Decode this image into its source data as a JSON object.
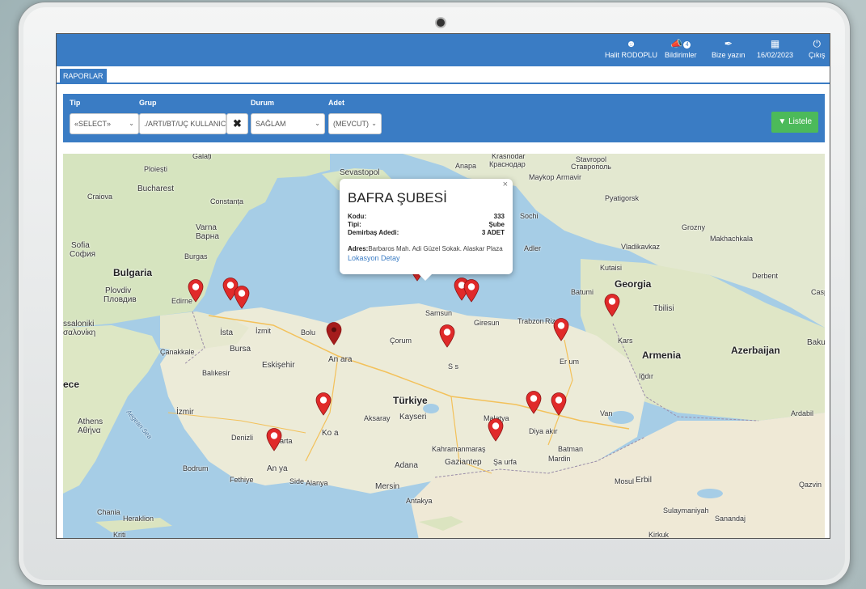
{
  "topbar": {
    "user": "Halit RODOPLU",
    "notifications": "Bildirimler",
    "notif_count": "4",
    "write": "Bize yazın",
    "date": "16/02/2023",
    "logout": "Çıkış"
  },
  "tabs": [
    "RAPORLAR"
  ],
  "filters": {
    "tip_label": "Tip",
    "tip_value": "«SELECT»",
    "grup_label": "Grup",
    "grup_value": "./ARTI/BT/UÇ KULLANICI",
    "durum_label": "Durum",
    "durum_value": "SAĞLAM",
    "adet_label": "Adet",
    "adet_value": "(MEVCUT)",
    "list_button": "Listele"
  },
  "popup": {
    "title": "BAFRA ŞUBESİ",
    "kodu_label": "Kodu:",
    "kodu_value": "333",
    "tipi_label": "Tipi:",
    "tipi_value": "Şube",
    "demirbas_label": "Demirbaş Adedi:",
    "demirbas_value": "3 ADET",
    "adres_label": "Adres:",
    "adres_value": "Barbaros Mah. Adi Güzel Sokak. Alaskar Plaza",
    "link": "Lokasyon Detay",
    "close": "×"
  },
  "map_labels": {
    "krasnodar": "Krasnodar",
    "krasnodar_ru": "Краснодар",
    "stavropol": "Stavropol",
    "stavropol_ru": "Ставрополь",
    "galati": "Galați",
    "ploiesti": "Ploiești",
    "sevastopol": "Sevastopol",
    "anapa": "Anapa",
    "maykop": "Maykop",
    "armavir": "Armavir",
    "craiova": "Craiova",
    "bucharest": "Bucharest",
    "constanta": "Constanța",
    "pyatigorsk": "Pyatigorsk",
    "varna": "Varna",
    "varna_bg": "Варна",
    "sochi": "Sochi",
    "grozny": "Grozny",
    "sofia": "Sofia",
    "sofia_bg": "София",
    "burgas": "Burgas",
    "adler": "Adler",
    "makhachkala": "Makhachkala",
    "vladikavkaz": "Vladikavkaz",
    "bulgaria": "Bulgaria",
    "kutaisi": "Kutaisi",
    "derbent": "Derbent",
    "plovdiv": "Plovdiv",
    "plovdiv_bg": "Пловдив",
    "edirne": "Edirne",
    "georgia": "Georgia",
    "batumi": "Batumi",
    "samsun": "Samsun",
    "tbilisi": "Tbilisi",
    "caspian": "Casp",
    "thessaloniki": "ssaloniki",
    "thessaloniki_gr": "σαλονίκη",
    "istanbul": "İsta",
    "izmit": "İzmit",
    "bolu": "Bolu",
    "giresun": "Giresun",
    "trabzon": "Trabzon",
    "rize": "Rize",
    "kars": "Kars",
    "baku": "Baku",
    "canakkale": "Çanakkale",
    "corum": "Çorum",
    "bursa": "Bursa",
    "armenia": "Armenia",
    "azerbaijan": "Azerbaijan",
    "balikesir": "Balıkesir",
    "eskisehir": "Eskişehir",
    "ankara": "An  ara",
    "sivas": "S  s",
    "erzurum": "Er  um",
    "igdir": "Iğdır",
    "greece": "ece",
    "turkiye": "Türkiye",
    "izmir": "İzmir",
    "aksaray": "Aksaray",
    "kayseri": "Kayseri",
    "malatya": "Malatya",
    "van": "Van",
    "ardabil": "Ardabil",
    "athens": "Athens",
    "athens_gr": "Αθήνα",
    "aegean": "Aegean Sea",
    "denizli": "Denizli",
    "isparta": "Isparta",
    "konya": "Ko  a",
    "diyarbakir": "Diya  akır",
    "batman": "Batman",
    "mardin": "Mardin",
    "kahramanmaras": "Kahramanmaraş",
    "gaziantep": "Gaziantep",
    "sanliurfa": "Şa  urfa",
    "adana": "Adana",
    "bodrum": "Bodrum",
    "fethiye": "Fethiye",
    "antalya": "An  ya",
    "side": "Side",
    "alanya": "Alanya",
    "mersin": "Mersin",
    "mosul": "Mosul",
    "erbil": "Erbil",
    "qazvin": "Qazvin",
    "chania": "Chania",
    "heraklion": "Heraklion",
    "antakya": "Antakya",
    "sulaymaniyah": "Sulaymaniyah",
    "sanandaj": "Sanandaj",
    "kirkuk": "Kirkuk",
    "kriti": "Kriti"
  },
  "colors": {
    "primary": "#3a7cc4",
    "success": "#4cba5a",
    "pin": "#e02a2a",
    "sea": "#a6cde6",
    "land": "#e8ead9"
  }
}
